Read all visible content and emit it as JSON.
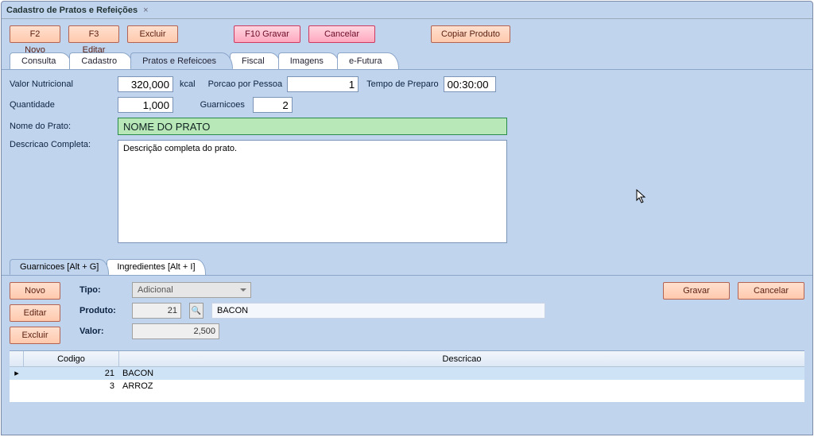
{
  "window": {
    "title": "Cadastro de Pratos e Refeições"
  },
  "toolbar": {
    "novo": "F2 Novo",
    "editar": "F3 Editar",
    "excluir": "Excluir",
    "gravar": "F10 Gravar",
    "cancelar": "Cancelar",
    "copiar": "Copiar Produto"
  },
  "tabs": {
    "consulta": "Consulta",
    "cadastro": "Cadastro",
    "pratos": "Pratos e Refeicoes",
    "fiscal": "Fiscal",
    "imagens": "Imagens",
    "efutura": "e-Futura"
  },
  "labels": {
    "valor_nutricional": "Valor Nutricional",
    "kcal": "kcal",
    "porcao": "Porcao por Pessoa",
    "tempo": "Tempo de Preparo",
    "quantidade": "Quantidade",
    "guarnicoes": "Guarnicoes",
    "nome_prato": "Nome do Prato:",
    "descricao": "Descricao Completa:"
  },
  "values": {
    "valor_nutricional": "320,000",
    "porcao": "1",
    "tempo": "00:30:00",
    "quantidade": "1,000",
    "guarnicoes": "2",
    "nome_prato": "NOME DO PRATO",
    "descricao": "Descrição completa do prato."
  },
  "subtabs": {
    "guarnicoes": "Guarnicoes [Alt + G]",
    "ingredientes": "Ingredientes [Alt + I]"
  },
  "subform": {
    "novo": "Novo",
    "editar": "Editar",
    "excluir": "Excluir",
    "gravar": "Gravar",
    "cancelar": "Cancelar",
    "tipo_lbl": "Tipo:",
    "produto_lbl": "Produto:",
    "valor_lbl": "Valor:",
    "tipo_val": "Adicional",
    "produto_code": "21",
    "produto_name": "BACON",
    "valor_val": "2,500"
  },
  "grid": {
    "col_codigo": "Codigo",
    "col_descricao": "Descricao",
    "rows": [
      {
        "codigo": "21",
        "descricao": "BACON"
      },
      {
        "codigo": "3",
        "descricao": "ARROZ"
      }
    ]
  }
}
